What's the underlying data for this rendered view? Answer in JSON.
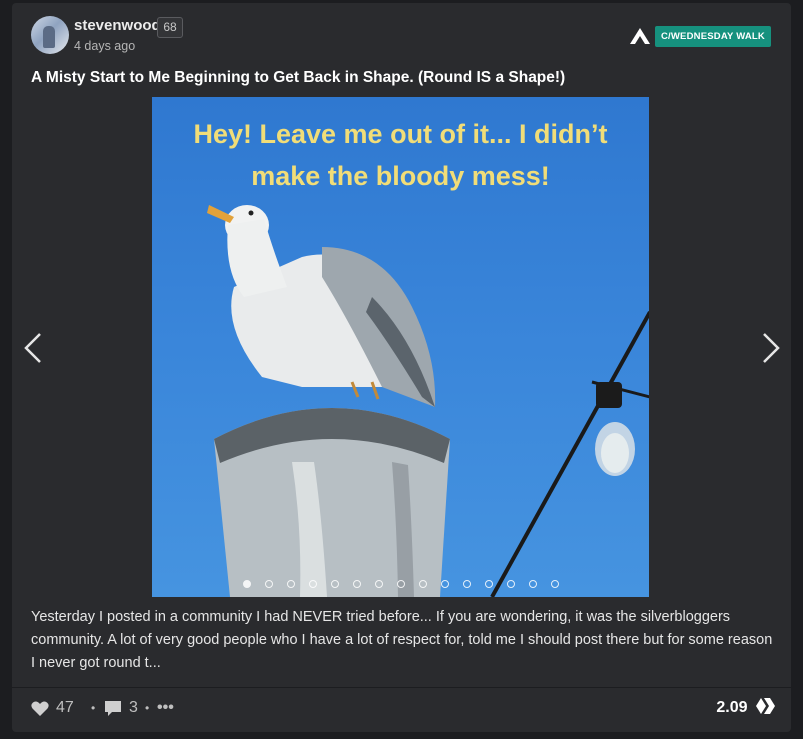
{
  "post": {
    "author": "stevenwood",
    "reputation": "68",
    "time_ago": "4 days ago",
    "community": "C/WEDNESDAY WALK",
    "title": "A Misty Start to Me Beginning to Get Back in Shape. (Round IS a Shape!)",
    "image_caption_line1": "Hey! Leave me out of it... I didn’t",
    "image_caption_line2": "make the bloody mess!",
    "excerpt": "Yesterday I posted in a community I had NEVER tried before... If you are wondering, it was the silverbloggers community. A lot of very good people who I have a lot of respect for, told me I should post there but for some reason I never got round t...",
    "carousel": {
      "total": 15,
      "active_index": 0
    }
  },
  "footer": {
    "likes": "47",
    "comments": "3",
    "sep": "•",
    "more": "•••",
    "payout": "2.09"
  },
  "colors": {
    "background": "#1c1d20",
    "card": "#2a2b2e",
    "badge": "#16917e",
    "caption": "#f1dd78",
    "sky": "#3a86da"
  },
  "icons": [
    "heart-icon",
    "comment-icon",
    "more-icon",
    "hive-icon",
    "community-logo-icon",
    "chevron-left-icon",
    "chevron-right-icon"
  ]
}
